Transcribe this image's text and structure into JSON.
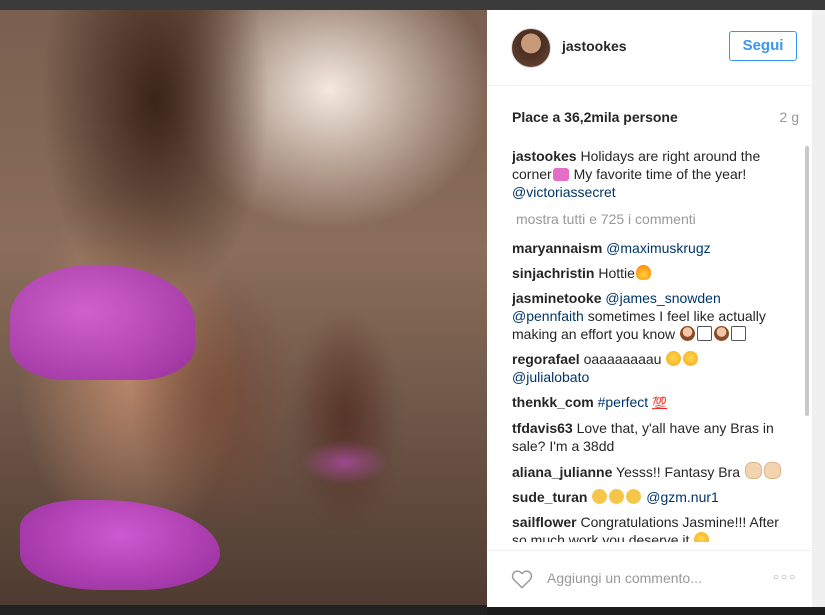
{
  "post": {
    "username": "jastookes",
    "follow_label": "Segui",
    "likes_text": "Place a 36,2mila persone",
    "age": "2 g"
  },
  "caption": {
    "username": "jastookes",
    "text_part1": "Holidays are right around the corner",
    "text_part2": " My favorite time of the year! ",
    "mention": "@victoriassecret"
  },
  "show_all_label": "mostra tutti e 725 i commenti",
  "comments": [
    {
      "user": "maryannaism",
      "mention": "@maximuskrugz"
    },
    {
      "user": "sinjachristin",
      "text": "Hottie"
    },
    {
      "user": "jasminetooke",
      "mention1": "@james_snowden",
      "mention2": "@pennfaith",
      "text": " sometimes I feel like actually making an effort you know "
    },
    {
      "user": "regorafael",
      "text": "oaaaaaaaau ",
      "mention": "@julialobato"
    },
    {
      "user": "thenkk_com",
      "hashtag": "#perfect",
      "emoji": "💯"
    },
    {
      "user": "tfdavis63",
      "text": "Love that, y'all have any Bras in sale? I'm a 38dd"
    },
    {
      "user": "aliana_julianne",
      "text": "Yesss!! Fantasy Bra "
    },
    {
      "user": "sude_turan",
      "mention": "@gzm.nur1"
    },
    {
      "user": "sailflower",
      "text": "Congratulations Jasmine!!! After so much work you deserve it "
    }
  ],
  "footer": {
    "add_comment_placeholder": "Aggiungi un commento...",
    "more_label": "○○○"
  },
  "icons": [
    "heart-icon",
    "more-options-icon"
  ],
  "colors": {
    "accent": "#3897f0",
    "mention": "#003569",
    "muted": "#999999",
    "text": "#262626"
  }
}
